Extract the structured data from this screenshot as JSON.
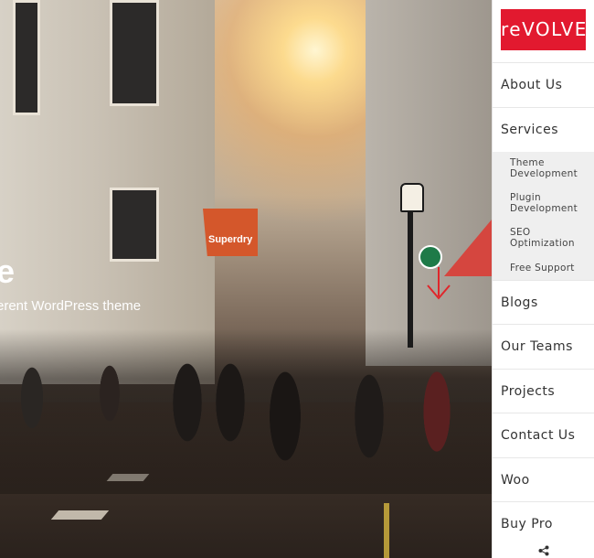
{
  "hero": {
    "title": "e",
    "subtitle": "erent WordPress theme",
    "flag_text": "Superdry"
  },
  "sidebar": {
    "logo_text": "reVOLVE",
    "items": [
      {
        "label": "About Us"
      },
      {
        "label": "Services"
      },
      {
        "label": "Blogs"
      },
      {
        "label": "Our Teams"
      },
      {
        "label": "Projects"
      },
      {
        "label": "Contact Us"
      },
      {
        "label": "Woo"
      },
      {
        "label": "Buy Pro"
      }
    ],
    "services_submenu": [
      {
        "label_line1": "Theme",
        "label_line2": "Development"
      },
      {
        "label_line1": "Plugin",
        "label_line2": "Development"
      },
      {
        "label_line1": "SEO",
        "label_line2": "Optimization"
      },
      {
        "label_line1": "Free Support",
        "label_line2": ""
      }
    ],
    "share_icon": "share-icon"
  },
  "colors": {
    "brand_red": "#e2192f",
    "menu_text": "#333333",
    "submenu_bg": "#efefef"
  }
}
